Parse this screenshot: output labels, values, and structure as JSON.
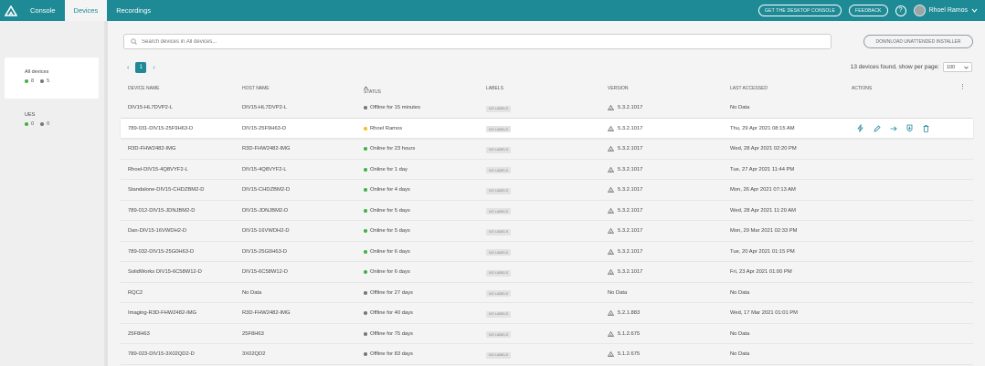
{
  "topbar": {
    "tabs": [
      {
        "label": "Console",
        "active": false
      },
      {
        "label": "Devices",
        "active": true
      },
      {
        "label": "Recordings",
        "active": false
      }
    ],
    "desktop_console_label": "GET THE DESKTOP CONSOLE",
    "feedback_label": "FEEDBACK",
    "help_label": "?",
    "user_name": "Rhoel Ramos"
  },
  "colors": {
    "brand": "#1e8a96",
    "online": "#43b047",
    "offline": "#777777",
    "busy": "#f2c01b"
  },
  "sidebar": {
    "groups": [
      {
        "name": "All devices",
        "online": "8",
        "offline": "5",
        "active": true
      },
      {
        "name": "UES",
        "online": "0",
        "offline": "0",
        "active": false
      }
    ]
  },
  "search": {
    "placeholder": "Search devices in All devices..."
  },
  "installer_label": "DOWNLOAD UNATTENDED INSTALLER",
  "pagination": {
    "current_page": "1",
    "prev": "‹",
    "next": "›"
  },
  "results": {
    "summary": "13 devices found, show per page:",
    "per_page": "100"
  },
  "table": {
    "headers": {
      "device_name": "DEVICE NAME",
      "host_name": "HOST NAME",
      "status": "STATUS",
      "labels": "LABELS",
      "version": "VERSION",
      "last_accessed": "LAST ACCESSED",
      "actions": "ACTIONS"
    },
    "rows": [
      {
        "device": "DIV15-HL7DVP2-L",
        "host": "DIV15-HL7DVP2-L",
        "status": "Offline for 15 minutes",
        "state": "offline",
        "label": "NO LABELS",
        "version": "5.3.2.1017",
        "accessed": "No Data"
      },
      {
        "device": "789-031-DIV15-25F9H63-D",
        "host": "DIV15-25F9H63-D",
        "status": "Rhoel Ramos",
        "state": "busy",
        "label": "NO LABELS",
        "version": "5.3.2.1017",
        "accessed": "Thu, 29 Apr 2021 08:15 AM"
      },
      {
        "device": "R3D-FHW2482-IMG",
        "host": "R3D-FHW2482-IMG",
        "status": "Online for 23 hours",
        "state": "online",
        "label": "NO LABELS",
        "version": "5.3.2.1017",
        "accessed": "Wed, 28 Apr 2021 02:20 PM"
      },
      {
        "device": "Rhoel-DIV15-4Q8VYF2-L",
        "host": "DIV15-4Q8VYF2-L",
        "status": "Online for 1 day",
        "state": "online",
        "label": "NO LABELS",
        "version": "5.3.2.1017",
        "accessed": "Tue, 27 Apr 2021 11:44 PM"
      },
      {
        "device": "Standalone-DIV15-CHDZBM2-D",
        "host": "DIV15-CHDZBM2-D",
        "status": "Online for 4 days",
        "state": "online",
        "label": "NO LABELS",
        "version": "5.3.2.1017",
        "accessed": "Mon, 26 Apr 2021 07:13 AM"
      },
      {
        "device": "789-012-DIV15-JDNJBM2-D",
        "host": "DIV15-JDNJBM2-D",
        "status": "Online for 5 days",
        "state": "online",
        "label": "NO LABELS",
        "version": "5.3.2.1017",
        "accessed": "Wed, 28 Apr 2021 11:20 AM"
      },
      {
        "device": "Dan-DIV15-16VWDH2-D",
        "host": "DIV15-16VWDH2-D",
        "status": "Online for 5 days",
        "state": "online",
        "label": "NO LABELS",
        "version": "5.3.2.1017",
        "accessed": "Mon, 29 Mar 2021 02:33 PM"
      },
      {
        "device": "789-032-DIV15-25G0H63-D",
        "host": "DIV15-25G0H63-D",
        "status": "Online for 6 days",
        "state": "online",
        "label": "NO LABELS",
        "version": "5.3.2.1017",
        "accessed": "Tue, 20 Apr 2021 01:15 PM"
      },
      {
        "device": "SolidWorks DIV15-6C58W12-D",
        "host": "DIV15-6C58W12-D",
        "status": "Online for 6 days",
        "state": "online",
        "label": "NO LABELS",
        "version": "5.3.2.1017",
        "accessed": "Fri, 23 Apr 2021 01:00 PM"
      },
      {
        "device": "RQC2",
        "host": "No Data",
        "status": "Offline for 27 days",
        "state": "offline",
        "label": "NO LABELS",
        "version": "No Data",
        "accessed": "No Data"
      },
      {
        "device": "Imaging-R3D-FHW2482-IMG",
        "host": "R3D-FHW2482-IMG",
        "status": "Offline for 40 days",
        "state": "offline",
        "label": "NO LABELS",
        "version": "5.2.1.883",
        "accessed": "Wed, 17 Mar 2021 01:01 PM"
      },
      {
        "device": "25F8H63",
        "host": "25F8H63",
        "status": "Offline for 75 days",
        "state": "offline",
        "label": "NO LABELS",
        "version": "5.1.2.675",
        "accessed": "No Data"
      },
      {
        "device": "789-023-DIV15-3X02QD2-D",
        "host": "3X02QD2",
        "status": "Offline for 83 days",
        "state": "offline",
        "label": "NO LABELS",
        "version": "5.1.2.675",
        "accessed": "No Data"
      }
    ],
    "action_icons": [
      "bolt-icon",
      "pencil-icon",
      "arrow-right-icon",
      "install-icon",
      "trash-icon"
    ]
  }
}
